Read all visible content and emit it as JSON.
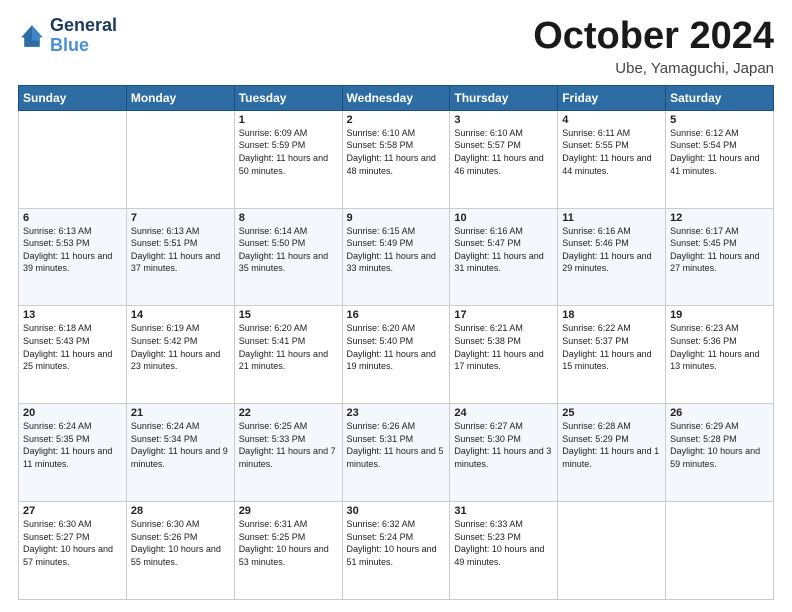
{
  "header": {
    "logo_line1": "General",
    "logo_line2": "Blue",
    "month": "October 2024",
    "location": "Ube, Yamaguchi, Japan"
  },
  "weekdays": [
    "Sunday",
    "Monday",
    "Tuesday",
    "Wednesday",
    "Thursday",
    "Friday",
    "Saturday"
  ],
  "weeks": [
    [
      {
        "day": "",
        "info": ""
      },
      {
        "day": "",
        "info": ""
      },
      {
        "day": "1",
        "info": "Sunrise: 6:09 AM\nSunset: 5:59 PM\nDaylight: 11 hours and 50 minutes."
      },
      {
        "day": "2",
        "info": "Sunrise: 6:10 AM\nSunset: 5:58 PM\nDaylight: 11 hours and 48 minutes."
      },
      {
        "day": "3",
        "info": "Sunrise: 6:10 AM\nSunset: 5:57 PM\nDaylight: 11 hours and 46 minutes."
      },
      {
        "day": "4",
        "info": "Sunrise: 6:11 AM\nSunset: 5:55 PM\nDaylight: 11 hours and 44 minutes."
      },
      {
        "day": "5",
        "info": "Sunrise: 6:12 AM\nSunset: 5:54 PM\nDaylight: 11 hours and 41 minutes."
      }
    ],
    [
      {
        "day": "6",
        "info": "Sunrise: 6:13 AM\nSunset: 5:53 PM\nDaylight: 11 hours and 39 minutes."
      },
      {
        "day": "7",
        "info": "Sunrise: 6:13 AM\nSunset: 5:51 PM\nDaylight: 11 hours and 37 minutes."
      },
      {
        "day": "8",
        "info": "Sunrise: 6:14 AM\nSunset: 5:50 PM\nDaylight: 11 hours and 35 minutes."
      },
      {
        "day": "9",
        "info": "Sunrise: 6:15 AM\nSunset: 5:49 PM\nDaylight: 11 hours and 33 minutes."
      },
      {
        "day": "10",
        "info": "Sunrise: 6:16 AM\nSunset: 5:47 PM\nDaylight: 11 hours and 31 minutes."
      },
      {
        "day": "11",
        "info": "Sunrise: 6:16 AM\nSunset: 5:46 PM\nDaylight: 11 hours and 29 minutes."
      },
      {
        "day": "12",
        "info": "Sunrise: 6:17 AM\nSunset: 5:45 PM\nDaylight: 11 hours and 27 minutes."
      }
    ],
    [
      {
        "day": "13",
        "info": "Sunrise: 6:18 AM\nSunset: 5:43 PM\nDaylight: 11 hours and 25 minutes."
      },
      {
        "day": "14",
        "info": "Sunrise: 6:19 AM\nSunset: 5:42 PM\nDaylight: 11 hours and 23 minutes."
      },
      {
        "day": "15",
        "info": "Sunrise: 6:20 AM\nSunset: 5:41 PM\nDaylight: 11 hours and 21 minutes."
      },
      {
        "day": "16",
        "info": "Sunrise: 6:20 AM\nSunset: 5:40 PM\nDaylight: 11 hours and 19 minutes."
      },
      {
        "day": "17",
        "info": "Sunrise: 6:21 AM\nSunset: 5:38 PM\nDaylight: 11 hours and 17 minutes."
      },
      {
        "day": "18",
        "info": "Sunrise: 6:22 AM\nSunset: 5:37 PM\nDaylight: 11 hours and 15 minutes."
      },
      {
        "day": "19",
        "info": "Sunrise: 6:23 AM\nSunset: 5:36 PM\nDaylight: 11 hours and 13 minutes."
      }
    ],
    [
      {
        "day": "20",
        "info": "Sunrise: 6:24 AM\nSunset: 5:35 PM\nDaylight: 11 hours and 11 minutes."
      },
      {
        "day": "21",
        "info": "Sunrise: 6:24 AM\nSunset: 5:34 PM\nDaylight: 11 hours and 9 minutes."
      },
      {
        "day": "22",
        "info": "Sunrise: 6:25 AM\nSunset: 5:33 PM\nDaylight: 11 hours and 7 minutes."
      },
      {
        "day": "23",
        "info": "Sunrise: 6:26 AM\nSunset: 5:31 PM\nDaylight: 11 hours and 5 minutes."
      },
      {
        "day": "24",
        "info": "Sunrise: 6:27 AM\nSunset: 5:30 PM\nDaylight: 11 hours and 3 minutes."
      },
      {
        "day": "25",
        "info": "Sunrise: 6:28 AM\nSunset: 5:29 PM\nDaylight: 11 hours and 1 minute."
      },
      {
        "day": "26",
        "info": "Sunrise: 6:29 AM\nSunset: 5:28 PM\nDaylight: 10 hours and 59 minutes."
      }
    ],
    [
      {
        "day": "27",
        "info": "Sunrise: 6:30 AM\nSunset: 5:27 PM\nDaylight: 10 hours and 57 minutes."
      },
      {
        "day": "28",
        "info": "Sunrise: 6:30 AM\nSunset: 5:26 PM\nDaylight: 10 hours and 55 minutes."
      },
      {
        "day": "29",
        "info": "Sunrise: 6:31 AM\nSunset: 5:25 PM\nDaylight: 10 hours and 53 minutes."
      },
      {
        "day": "30",
        "info": "Sunrise: 6:32 AM\nSunset: 5:24 PM\nDaylight: 10 hours and 51 minutes."
      },
      {
        "day": "31",
        "info": "Sunrise: 6:33 AM\nSunset: 5:23 PM\nDaylight: 10 hours and 49 minutes."
      },
      {
        "day": "",
        "info": ""
      },
      {
        "day": "",
        "info": ""
      }
    ]
  ]
}
